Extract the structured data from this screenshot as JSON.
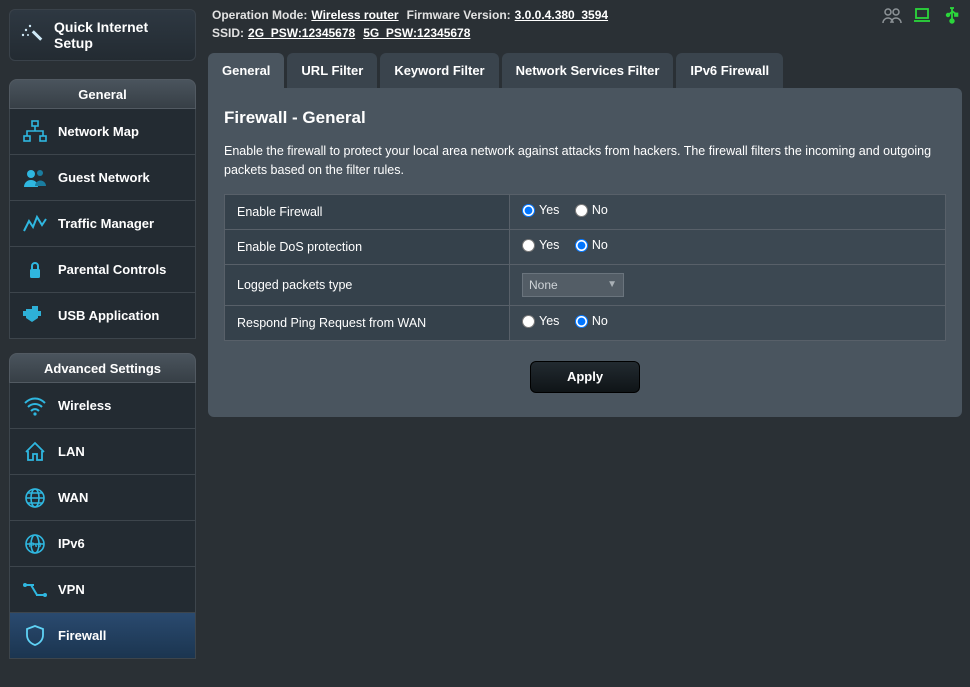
{
  "header": {
    "op_mode_label": "Operation Mode:",
    "op_mode_value": "Wireless router",
    "fw_label": "Firmware Version:",
    "fw_value": "3.0.0.4.380_3594",
    "ssid_label": "SSID:",
    "ssid_2g": "2G_PSW:12345678",
    "ssid_5g": "5G_PSW:12345678"
  },
  "qis": {
    "label": "Quick Internet Setup"
  },
  "sidebar": {
    "general_heading": "General",
    "advanced_heading": "Advanced Settings",
    "general_items": [
      {
        "label": "Network Map"
      },
      {
        "label": "Guest Network"
      },
      {
        "label": "Traffic Manager"
      },
      {
        "label": "Parental Controls"
      },
      {
        "label": "USB Application"
      }
    ],
    "advanced_items": [
      {
        "label": "Wireless"
      },
      {
        "label": "LAN"
      },
      {
        "label": "WAN"
      },
      {
        "label": "IPv6"
      },
      {
        "label": "VPN"
      },
      {
        "label": "Firewall"
      }
    ]
  },
  "tabs": {
    "items": [
      "General",
      "URL Filter",
      "Keyword Filter",
      "Network Services Filter",
      "IPv6 Firewall"
    ]
  },
  "page": {
    "title": "Firewall - General",
    "desc": "Enable the firewall to protect your local area network against attacks from hackers. The firewall filters the incoming and outgoing packets based on the filter rules.",
    "yes": "Yes",
    "no": "No",
    "rows": {
      "enable_firewall": "Enable Firewall",
      "enable_dos": "Enable DoS protection",
      "logged_type": "Logged packets type",
      "respond_ping": "Respond Ping Request from WAN"
    },
    "logged_value": "None",
    "apply": "Apply",
    "values": {
      "enable_firewall": "Yes",
      "enable_dos": "No",
      "respond_ping": "No"
    }
  }
}
